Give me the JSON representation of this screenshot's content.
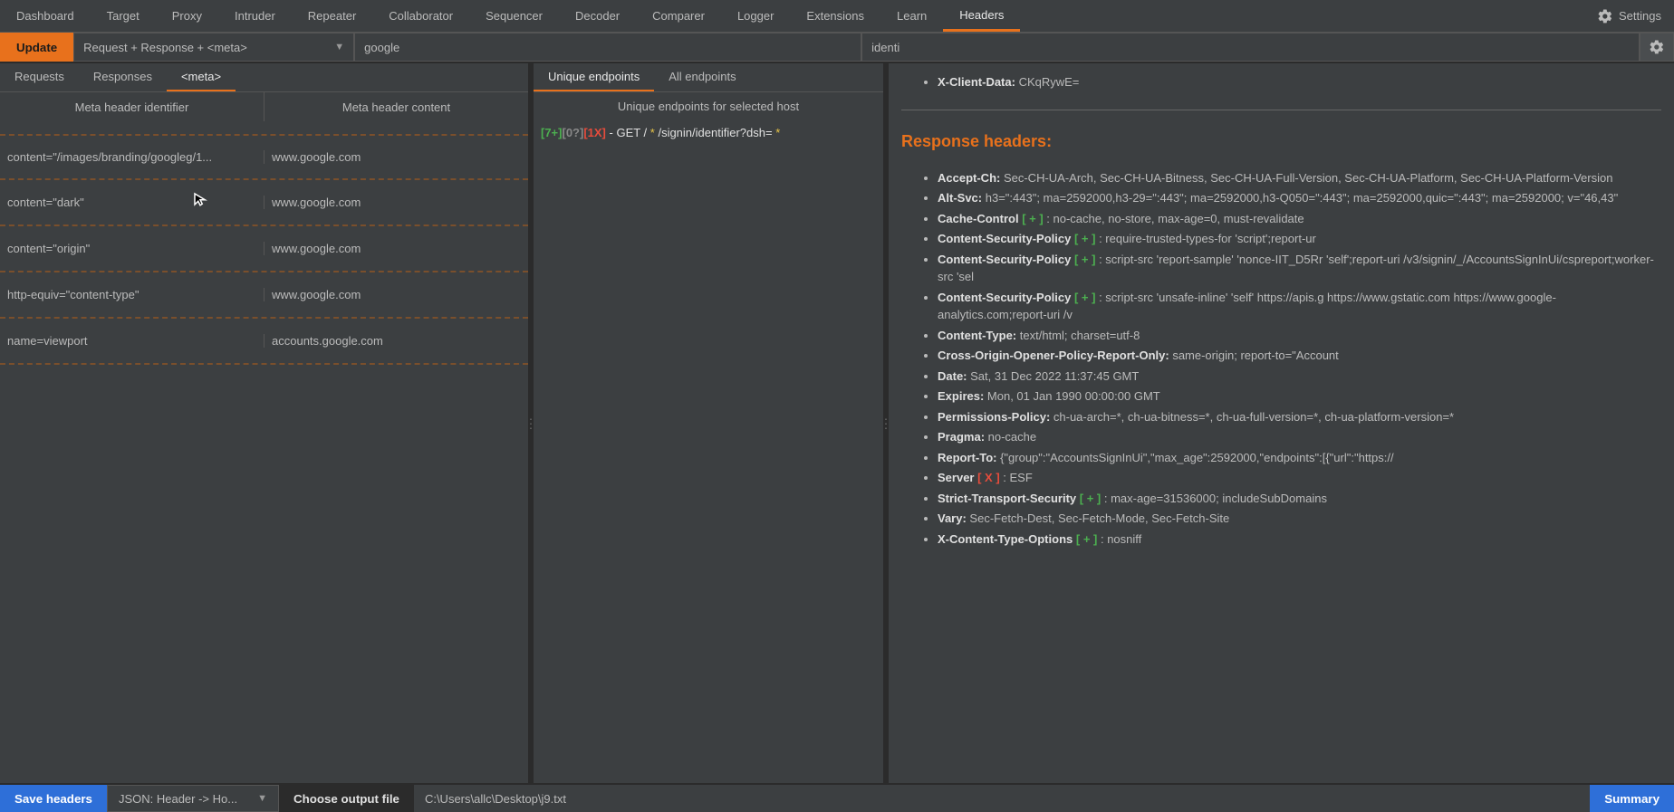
{
  "topTabs": [
    "Dashboard",
    "Target",
    "Proxy",
    "Intruder",
    "Repeater",
    "Collaborator",
    "Sequencer",
    "Decoder",
    "Comparer",
    "Logger",
    "Extensions",
    "Learn",
    "Headers"
  ],
  "activeTopTab": "Headers",
  "settingsLabel": "Settings",
  "updateBtn": "Update",
  "modeDropdown": "Request + Response + <meta>",
  "search1": "google",
  "search2": "identi",
  "leftTabs": [
    "Requests",
    "Responses",
    "<meta>"
  ],
  "activeLeftTab": "<meta>",
  "tableCols": [
    "Meta header identifier",
    "Meta header content"
  ],
  "metaRows": [
    {
      "id": "content=\"/images/branding/googleg/1...",
      "content": "www.google.com"
    },
    {
      "id": "content=\"dark\"",
      "content": "www.google.com"
    },
    {
      "id": "content=\"origin\"",
      "content": "www.google.com"
    },
    {
      "id": "http-equiv=\"content-type\"",
      "content": "www.google.com"
    },
    {
      "id": "name=viewport",
      "content": "accounts.google.com"
    }
  ],
  "midTabs": [
    "Unique endpoints",
    "All endpoints"
  ],
  "activeMidTab": "Unique endpoints",
  "midHeader": "Unique endpoints for selected host",
  "endpoint": {
    "plus": "[7+]",
    "gray": "[0?]",
    "red": "[1X]",
    "dash": " - ",
    "method": "GET / ",
    "star1": "*",
    "path": " /signin/identifier?dsh= ",
    "star2": "*"
  },
  "xClientKey": "X-Client-Data:",
  "xClientVal": " CKqRywE=",
  "respTitle": "Response headers:",
  "respHeaders": [
    {
      "key": "Accept-Ch:",
      "val": " Sec-CH-UA-Arch, Sec-CH-UA-Bitness, Sec-CH-UA-Full-Version, Sec-CH-UA-Platform, Sec-CH-UA-Platform-Version"
    },
    {
      "key": "Alt-Svc:",
      "val": " h3=\":443\"; ma=2592000,h3-29=\":443\"; ma=2592000,h3-Q050=\":443\"; ma=2592000,quic=\":443\"; ma=2592000; v=\"46,43\""
    },
    {
      "key": "Cache-Control",
      "tag": "[ + ]",
      "val": " : no-cache, no-store, max-age=0, must-revalidate"
    },
    {
      "key": "Content-Security-Policy",
      "tag": "[ + ]",
      "val": " : require-trusted-types-for 'script';report-ur"
    },
    {
      "key": "Content-Security-Policy",
      "tag": "[ + ]",
      "val": " : script-src 'report-sample' 'nonce-IIT_D5Rr 'self';report-uri /v3/signin/_/AccountsSignInUi/cspreport;worker-src 'sel"
    },
    {
      "key": "Content-Security-Policy",
      "tag": "[ + ]",
      "val": " : script-src 'unsafe-inline' 'self' https://apis.g https://www.gstatic.com https://www.google-analytics.com;report-uri /v"
    },
    {
      "key": "Content-Type:",
      "val": " text/html; charset=utf-8"
    },
    {
      "key": "Cross-Origin-Opener-Policy-Report-Only:",
      "val": " same-origin; report-to=\"Account"
    },
    {
      "key": "Date:",
      "val": " Sat, 31 Dec 2022 11:37:45 GMT"
    },
    {
      "key": "Expires:",
      "val": " Mon, 01 Jan 1990 00:00:00 GMT"
    },
    {
      "key": "Permissions-Policy:",
      "val": " ch-ua-arch=*, ch-ua-bitness=*, ch-ua-full-version=*, ch-ua-platform-version=*"
    },
    {
      "key": "Pragma:",
      "val": " no-cache"
    },
    {
      "key": "Report-To:",
      "val": " {\"group\":\"AccountsSignInUi\",\"max_age\":2592000,\"endpoints\":[{\"url\":\"https://"
    },
    {
      "key": "Server",
      "tag": "[ X ]",
      "tagClass": "x",
      "val": " : ESF"
    },
    {
      "key": "Strict-Transport-Security",
      "tag": "[ + ]",
      "val": " : max-age=31536000; includeSubDomains"
    },
    {
      "key": "Vary:",
      "val": " Sec-Fetch-Dest, Sec-Fetch-Mode, Sec-Fetch-Site"
    },
    {
      "key": "X-Content-Type-Options",
      "tag": "[ + ]",
      "val": " : nosniff"
    }
  ],
  "saveBtn": "Save headers",
  "jsonDropdown": "JSON: Header -> Ho...",
  "chooseBtn": "Choose output file",
  "outputPath": "C:\\Users\\allc\\Desktop\\j9.txt",
  "summaryBtn": "Summary"
}
